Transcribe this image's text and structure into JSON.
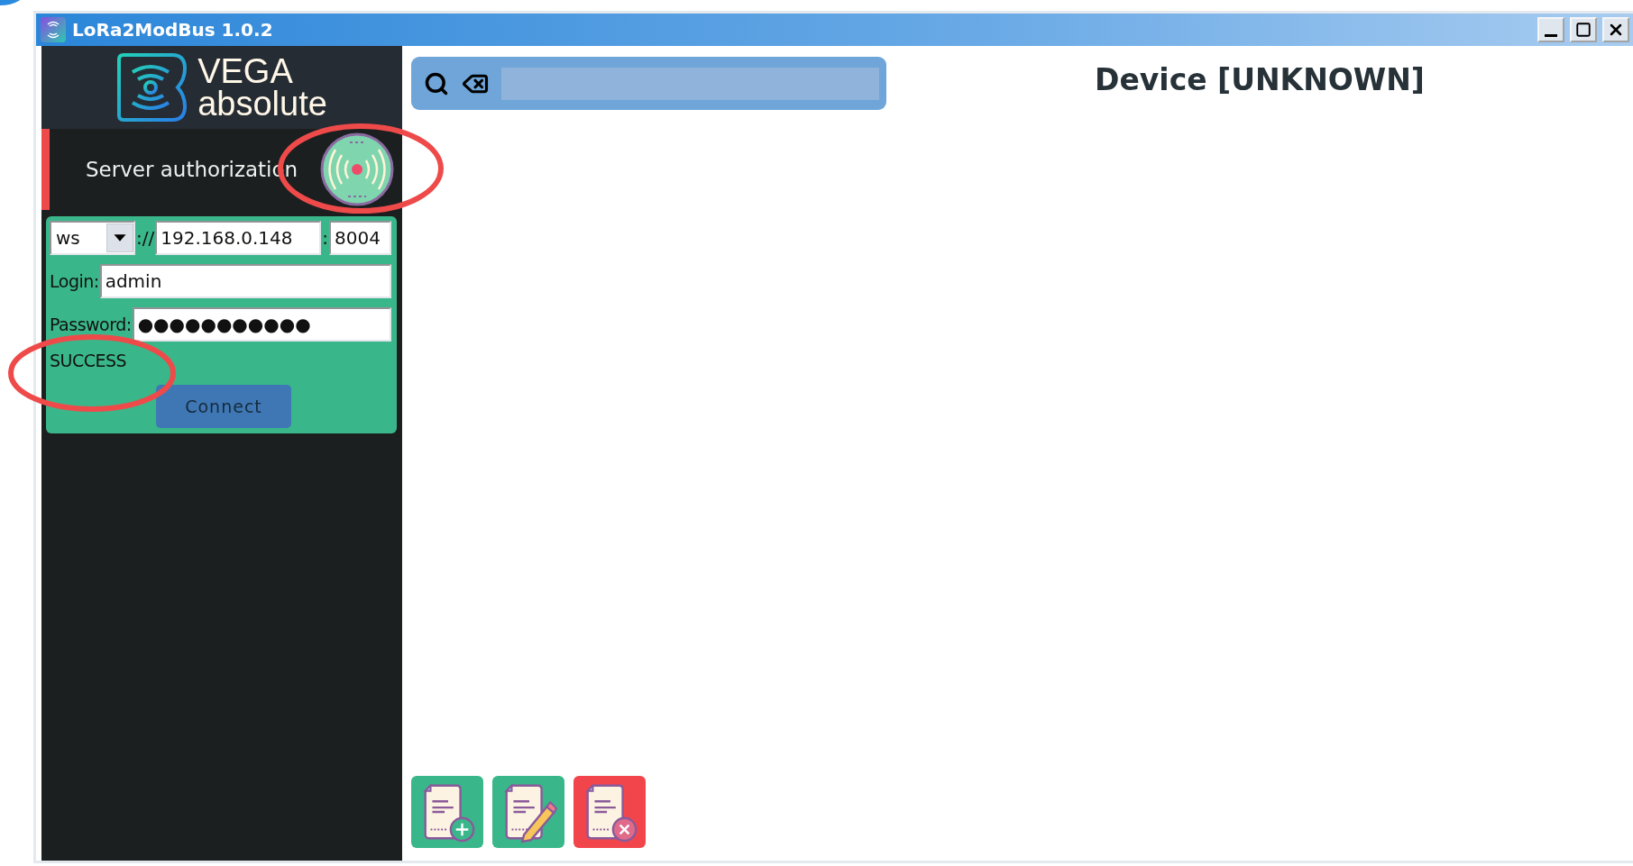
{
  "window": {
    "title": "LoRa2ModBus 1.0.2"
  },
  "sidebar": {
    "logo": {
      "line_1": "VEGA",
      "line_2": "absolute"
    },
    "section": {
      "title": "Server authorization",
      "active": true
    },
    "connection": {
      "protocol": "ws",
      "separator": "://",
      "host": "192.168.0.148",
      "port_separator": ":",
      "port": "8004",
      "login_label": "Login:",
      "login": "admin",
      "password_label": "Password:",
      "password": "●●●●●●●●●●●",
      "status": "SUCCESS",
      "connect_button": "Connect"
    }
  },
  "device_title": "Device [UNKNOWN]",
  "actions": [
    {
      "kind": "add"
    },
    {
      "kind": "edit"
    },
    {
      "kind": "delete"
    }
  ]
}
